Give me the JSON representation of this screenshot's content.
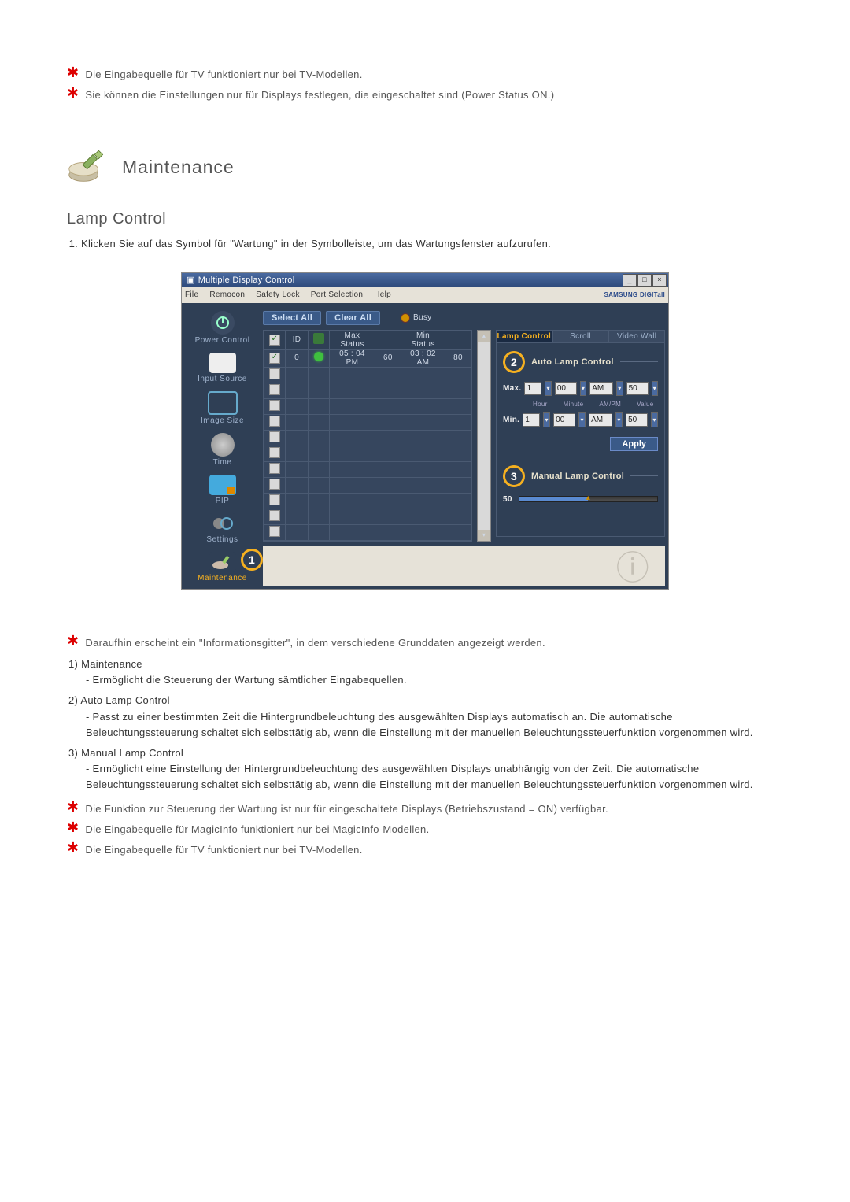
{
  "notes_top": [
    "Die Eingabequelle für TV funktioniert nur bei TV-Modellen.",
    "Sie können die Einstellungen nur für Displays festlegen, die eingeschaltet sind (Power Status ON.)"
  ],
  "section": {
    "title": "Maintenance",
    "subtitle": "Lamp Control",
    "step1": "Klicken Sie auf das Symbol für \"Wartung\" in der Symbolleiste, um das Wartungsfenster aufzurufen."
  },
  "app": {
    "window_title": "Multiple Display Control",
    "menubar": [
      "File",
      "Remocon",
      "Safety Lock",
      "Port Selection",
      "Help"
    ],
    "brand": "SAMSUNG DIGITall",
    "select_all": "Select All",
    "clear_all": "Clear All",
    "busy": "Busy",
    "sidebar": [
      {
        "label": "Power Control"
      },
      {
        "label": "Input Source"
      },
      {
        "label": "Image Size"
      },
      {
        "label": "Time"
      },
      {
        "label": "PIP"
      },
      {
        "label": "Settings"
      },
      {
        "label": "Maintenance"
      }
    ],
    "callouts": {
      "c1": "1",
      "c2": "2",
      "c3": "3"
    },
    "table": {
      "headers": {
        "chk": "☑",
        "id": "ID",
        "status": "",
        "max_status": "Max Status",
        "max_val": "",
        "min_status": "Min Status",
        "min_val": ""
      },
      "row": {
        "id": "0",
        "max_status": "05 : 04 PM",
        "max_val": "60",
        "min_status": "03 : 02 AM",
        "min_val": "80"
      }
    },
    "right": {
      "tabs": [
        "Lamp Control",
        "Scroll",
        "Video Wall"
      ],
      "auto_label": "Auto Lamp Control",
      "manual_label": "Manual Lamp Control",
      "max_label": "Max.",
      "min_label": "Min.",
      "col_labels": [
        "Hour",
        "Minute",
        "AM/PM",
        "Value"
      ],
      "max": {
        "hour": "1",
        "minute": "00",
        "ampm": "AM",
        "value": "50"
      },
      "min": {
        "hour": "1",
        "minute": "00",
        "ampm": "AM",
        "value": "50"
      },
      "apply": "Apply",
      "manual_value": "50"
    }
  },
  "grid_note": "Daraufhin erscheint ein \"Informationsgitter\", in dem verschiedene Grunddaten angezeigt werden.",
  "desc": {
    "n1": "1)",
    "t1": "Maintenance",
    "d1": "- Ermöglicht die Steuerung der Wartung sämtlicher Eingabequellen.",
    "n2": "2)",
    "t2": "Auto Lamp Control",
    "d2": "- Passt zu einer bestimmten Zeit die Hintergrundbeleuchtung des ausgewählten Displays automatisch an. Die automatische Beleuchtungssteuerung schaltet sich selbsttätig ab, wenn die Einstellung mit der manuellen Beleuchtungssteuerfunktion vorgenommen wird.",
    "n3": "3)",
    "t3": "Manual Lamp Control",
    "d3": "- Ermöglicht eine Einstellung der Hintergrundbeleuchtung des ausgewählten Displays unabhängig von der Zeit. Die automatische Beleuchtungssteuerung schaltet sich selbsttätig ab, wenn die Einstellung mit der manuellen Beleuchtungssteuerfunktion vorgenommen wird."
  },
  "notes_bottom": [
    "Die Funktion zur Steuerung der Wartung ist nur für eingeschaltete Displays (Betriebszustand = ON) verfügbar.",
    "Die Eingabequelle für MagicInfo funktioniert nur bei MagicInfo-Modellen.",
    "Die Eingabequelle für TV funktioniert nur bei TV-Modellen."
  ]
}
